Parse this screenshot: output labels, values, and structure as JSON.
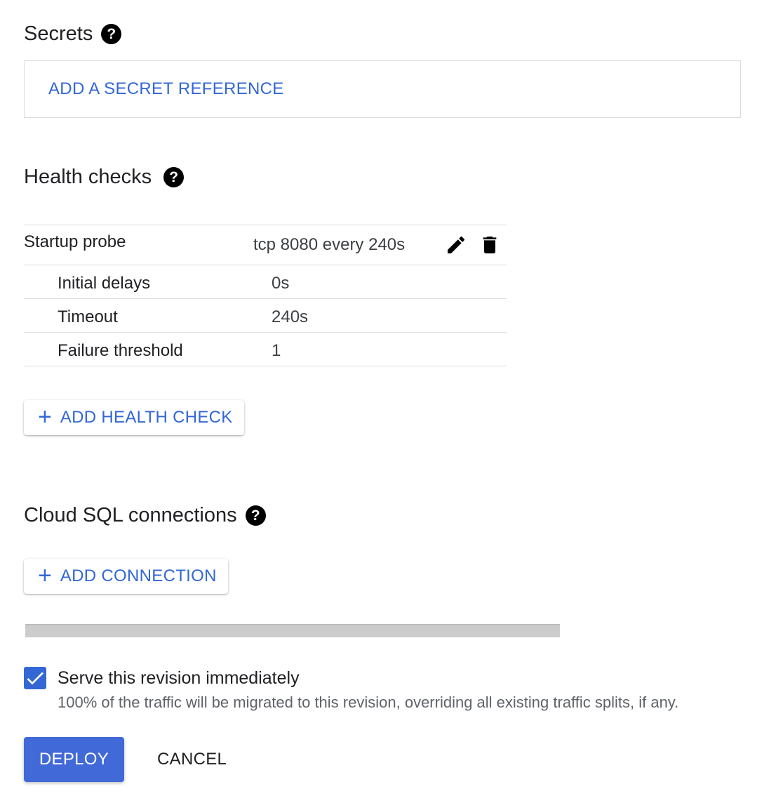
{
  "secrets": {
    "title": "Secrets",
    "help_glyph": "?",
    "add_label": "ADD A SECRET REFERENCE"
  },
  "health_checks": {
    "title": "Health checks",
    "help_glyph": "?",
    "probe": {
      "name": "Startup probe",
      "summary": "tcp 8080 every 240s",
      "details": [
        {
          "label": "Initial delays",
          "value": "0s"
        },
        {
          "label": "Timeout",
          "value": "240s"
        },
        {
          "label": "Failure threshold",
          "value": "1"
        }
      ]
    },
    "icons": [
      "pencil-icon",
      "trash-icon"
    ],
    "add_plus": "+",
    "add_label": "ADD HEALTH CHECK"
  },
  "cloud_sql": {
    "title": "Cloud SQL connections",
    "help_glyph": "?",
    "add_plus": "+",
    "add_label": "ADD CONNECTION"
  },
  "serve": {
    "checked": true,
    "label": "Serve this revision immediately",
    "hint": "100% of the traffic will be migrated to this revision, overriding all existing traffic splits, if any."
  },
  "actions": {
    "deploy_label": "DEPLOY",
    "cancel_label": "CANCEL"
  },
  "colors": {
    "accent": "#3367d6",
    "deploy_bg": "#4169d8",
    "divider": "#dadce0",
    "progress_track": "#cccccc"
  }
}
